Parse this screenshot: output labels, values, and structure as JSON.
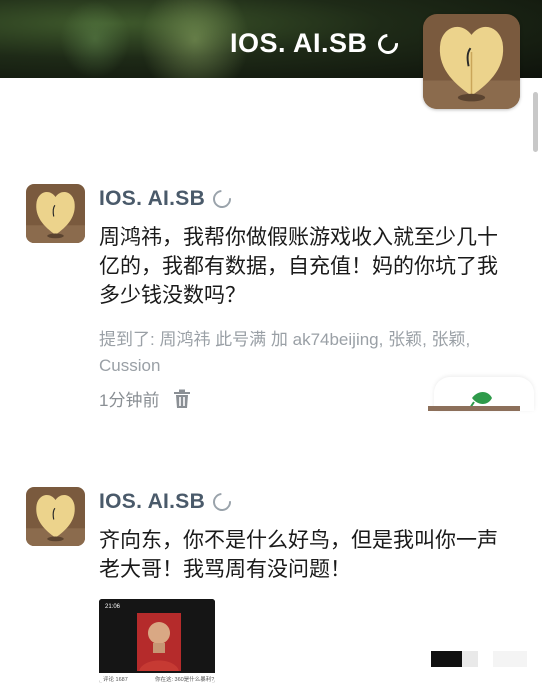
{
  "header": {
    "title": "IOS. AI.SB",
    "verified_icon": "loading-ring-icon"
  },
  "posts": [
    {
      "author": "IOS. AI.SB",
      "badge_icon": "ring-icon",
      "text": "周鸿祎，我帮你做假账游戏收入就至少几十亿的，我都有数据，自充值！妈的你坑了我多少钱没数吗？",
      "mentions": "提到了: 周鸿祎 此号满 加 ak74beijing, 张颖, 张颖, Cussion",
      "time": "1分钟前",
      "action_icon": "trash-icon"
    },
    {
      "author": "IOS. AI.SB",
      "badge_icon": "ring-icon",
      "text": "齐向东，你不是什么好鸟，但是我叫你一声老大哥！我骂周有没问题！",
      "media": {
        "status_time": "21:06",
        "footer_left": "评论 1687",
        "footer_right": "你在这: 360是什么暴利?"
      }
    }
  ],
  "colors": {
    "author": "#4a5a6a",
    "meta": "#9aa0a6",
    "body_text": "#1a1a1a"
  }
}
